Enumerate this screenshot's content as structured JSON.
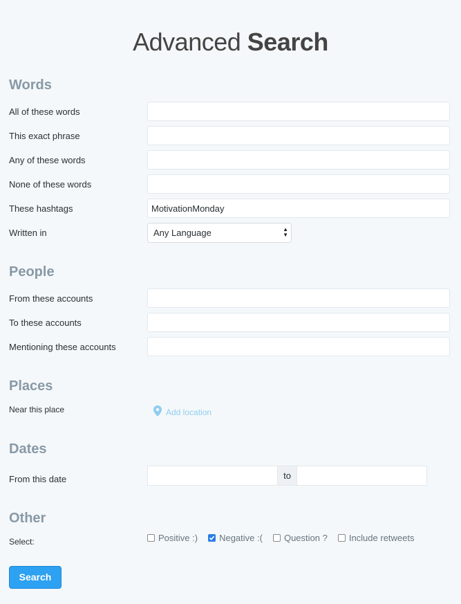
{
  "title": {
    "light": "Advanced",
    "bold": "Search"
  },
  "words": {
    "heading": "Words",
    "fields": [
      {
        "label": "All of these words",
        "value": ""
      },
      {
        "label": "This exact phrase",
        "value": ""
      },
      {
        "label": "Any of these words",
        "value": ""
      },
      {
        "label": "None of these words",
        "value": ""
      },
      {
        "label": "These hashtags",
        "value": "MotivationMonday"
      }
    ],
    "language": {
      "label": "Written in",
      "selected": "Any Language"
    }
  },
  "people": {
    "heading": "People",
    "fields": [
      {
        "label": "From these accounts",
        "value": ""
      },
      {
        "label": "To these accounts",
        "value": ""
      },
      {
        "label": "Mentioning these accounts",
        "value": ""
      }
    ]
  },
  "places": {
    "heading": "Places",
    "label": "Near this place",
    "add_location": "Add location",
    "icon": "location-pin-icon"
  },
  "dates": {
    "heading": "Dates",
    "label": "From this date",
    "separator": "to"
  },
  "other": {
    "heading": "Other",
    "label": "Select:",
    "options": [
      {
        "label": "Positive :)",
        "checked": false
      },
      {
        "label": "Negative :(",
        "checked": true
      },
      {
        "label": "Question ?",
        "checked": false
      },
      {
        "label": "Include retweets",
        "checked": false
      }
    ]
  },
  "search_button": "Search",
  "colors": {
    "accent": "#2da1f2",
    "heading": "#8899a6",
    "link": "#8ecdf0"
  }
}
